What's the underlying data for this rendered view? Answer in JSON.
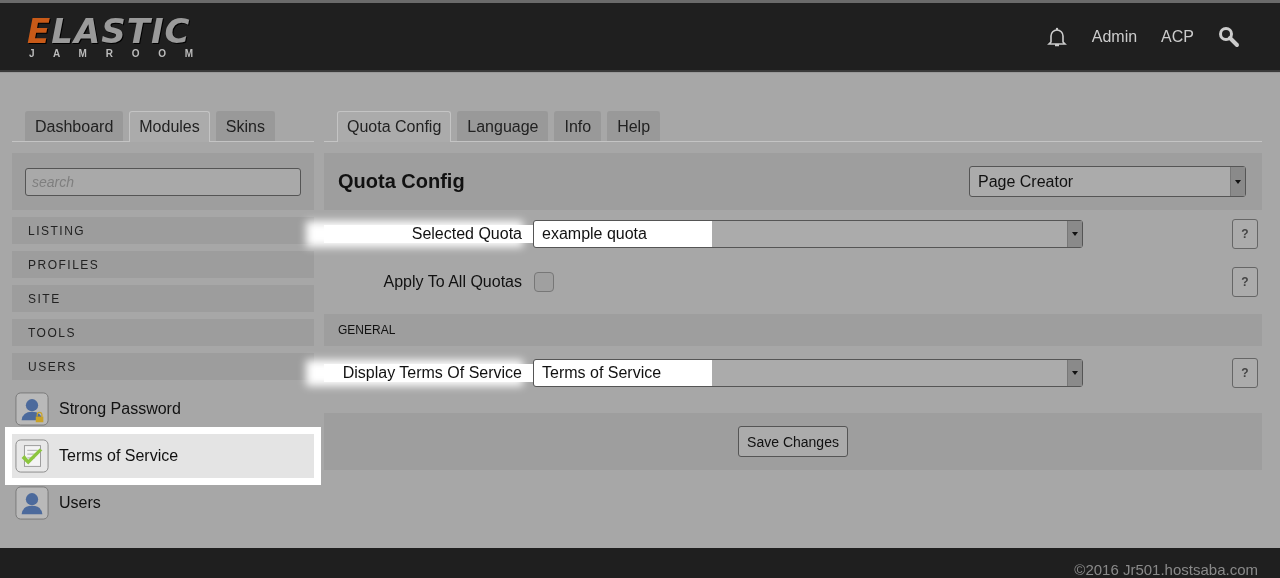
{
  "header": {
    "logo": {
      "word": "ELASTIC",
      "subtitle": "J A M R O O M"
    },
    "links": [
      "Admin",
      "ACP"
    ]
  },
  "sidebar": {
    "tabs": [
      {
        "label": "Dashboard",
        "selected": false
      },
      {
        "label": "Modules",
        "selected": true
      },
      {
        "label": "Skins",
        "selected": false
      }
    ],
    "search": {
      "placeholder": "search"
    },
    "sections": [
      "LISTING",
      "PROFILES",
      "SITE",
      "TOOLS",
      "USERS"
    ],
    "items": [
      {
        "label": "Strong Password",
        "kind": "lock-user",
        "selected": false
      },
      {
        "label": "Terms of Service",
        "kind": "check-doc",
        "selected": true
      },
      {
        "label": "Users",
        "kind": "user",
        "selected": false
      }
    ]
  },
  "main": {
    "tabs": [
      {
        "label": "Quota Config",
        "selected": true
      },
      {
        "label": "Language",
        "selected": false
      },
      {
        "label": "Info",
        "selected": false
      },
      {
        "label": "Help",
        "selected": false
      }
    ],
    "title": "Quota Config",
    "module_select": "Page Creator",
    "rows": [
      {
        "kind": "select",
        "label": "Selected Quota",
        "value": "example quota",
        "highlighted": true,
        "help": "?"
      },
      {
        "kind": "checkbox",
        "label": "Apply To All Quotas",
        "checked": false,
        "highlighted": false,
        "help": "?"
      },
      {
        "kind": "section",
        "label": "GENERAL"
      },
      {
        "kind": "select",
        "label": "Display Terms Of Service",
        "value": "Terms of Service",
        "highlighted": true,
        "help": "?"
      }
    ],
    "save_button": "Save Changes"
  },
  "footer": "©2016 Jr501.hostsaba.com"
}
